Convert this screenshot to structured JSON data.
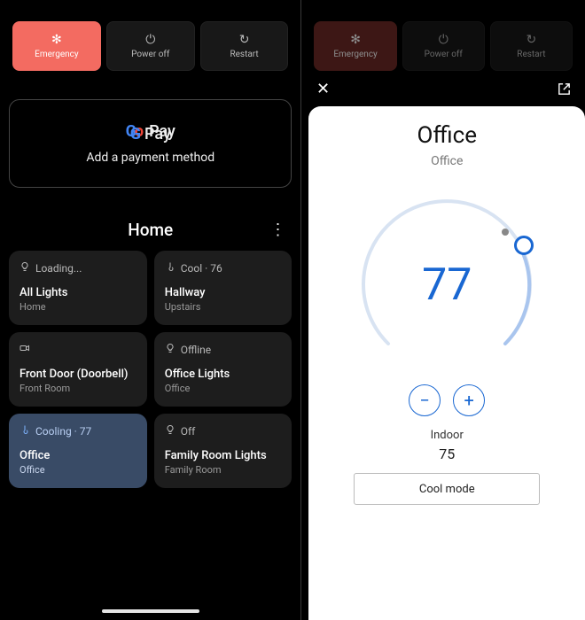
{
  "left": {
    "power": {
      "emergency": "Emergency",
      "poweroff": "Power off",
      "restart": "Restart"
    },
    "gpay": {
      "brand": "Pay",
      "subtitle": "Add a payment method"
    },
    "home": {
      "title": "Home"
    },
    "tiles": [
      {
        "status": "Loading...",
        "name": "All Lights",
        "room": "Home",
        "icon": "bulb",
        "active": false
      },
      {
        "status": "Cool · 76",
        "name": "Hallway",
        "room": "Upstairs",
        "icon": "thermostat",
        "active": false
      },
      {
        "status": "",
        "name": "Front Door (Doorbell)",
        "room": "Front Room",
        "icon": "camera",
        "active": false
      },
      {
        "status": "Offline",
        "name": "Office Lights",
        "room": "Office",
        "icon": "bulb",
        "active": false
      },
      {
        "status": "Cooling · 77",
        "name": "Office",
        "room": "Office",
        "icon": "thermostat",
        "active": true
      },
      {
        "status": "Off",
        "name": "Family Room Lights",
        "room": "Family Room",
        "icon": "bulb",
        "active": false
      }
    ]
  },
  "right": {
    "power": {
      "emergency": "Emergency",
      "poweroff": "Power off",
      "restart": "Restart"
    },
    "sheet": {
      "title": "Office",
      "subtitle": "Office",
      "set_temp": "77",
      "indoor_label": "Indoor",
      "indoor_value": "75",
      "mode": "Cool mode"
    }
  },
  "colors": {
    "accent": "#1967d2",
    "emergency": "#f36b61"
  }
}
